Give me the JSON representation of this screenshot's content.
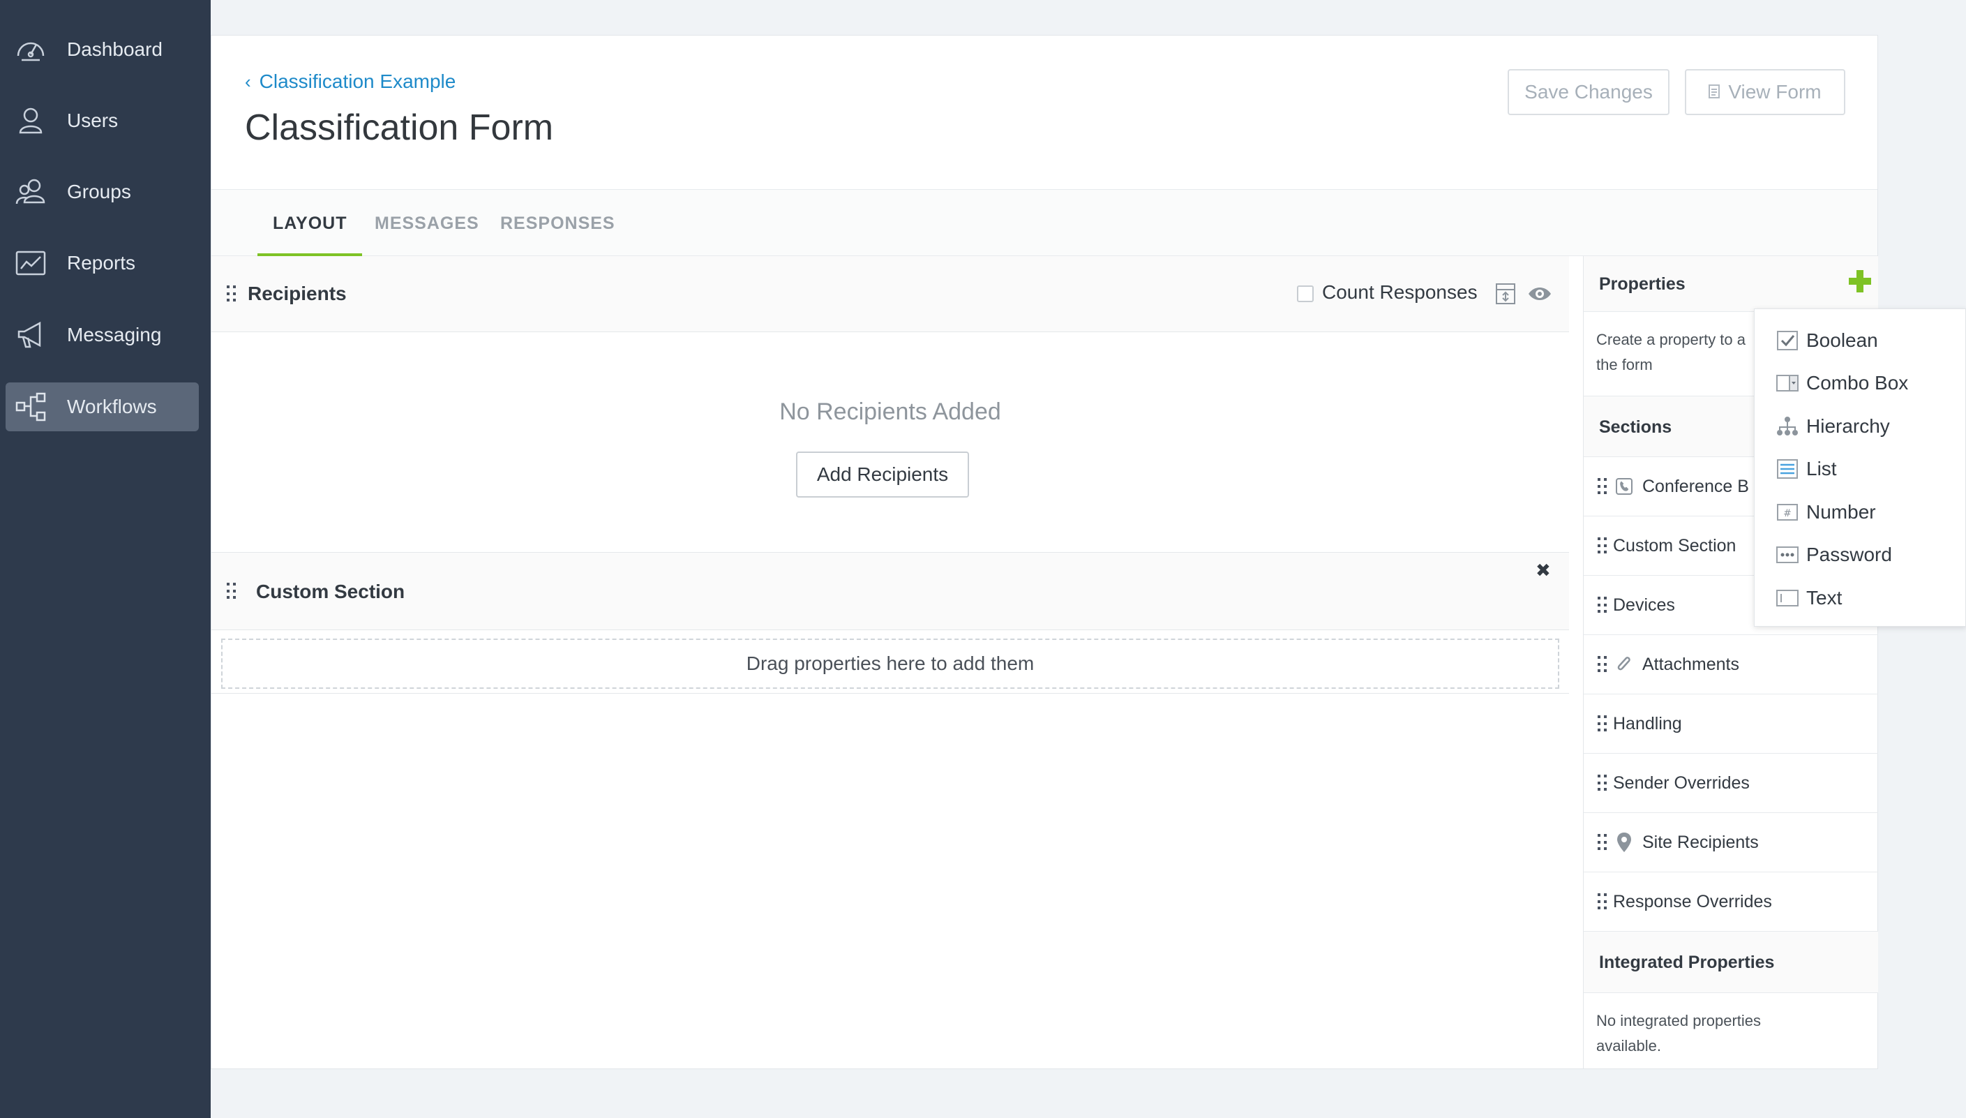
{
  "sidebar": {
    "items": [
      {
        "label": "Dashboard",
        "icon": "dashboard-icon"
      },
      {
        "label": "Users",
        "icon": "user-icon"
      },
      {
        "label": "Groups",
        "icon": "groups-icon"
      },
      {
        "label": "Reports",
        "icon": "reports-icon"
      },
      {
        "label": "Messaging",
        "icon": "megaphone-icon"
      },
      {
        "label": "Workflows",
        "icon": "workflow-icon",
        "active": true
      }
    ]
  },
  "header": {
    "breadcrumb": "Classification Example",
    "title": "Classification Form",
    "save_label": "Save Changes",
    "view_label": "View Form"
  },
  "tabs": [
    {
      "label": "LAYOUT",
      "active": true
    },
    {
      "label": "MESSAGES"
    },
    {
      "label": "RESPONSES"
    }
  ],
  "recipients": {
    "title": "Recipients",
    "count_label": "Count Responses",
    "count_checked": false,
    "empty_text": "No Recipients Added",
    "add_label": "Add Recipients"
  },
  "custom_section": {
    "title": "Custom Section",
    "dropzone_text": "Drag properties here to add them"
  },
  "properties": {
    "title": "Properties",
    "desc_line1": "Create a property to a",
    "desc_line2": "the form",
    "sections_title": "Sections",
    "sections": [
      {
        "label": "Conference B",
        "icon": "phone-icon"
      },
      {
        "label": "Custom Section"
      },
      {
        "label": "Devices"
      },
      {
        "label": "Attachments",
        "icon": "paperclip-icon"
      },
      {
        "label": "Handling"
      },
      {
        "label": "Sender Overrides"
      },
      {
        "label": "Site Recipients",
        "icon": "map-pin-icon"
      },
      {
        "label": "Response Overrides"
      }
    ],
    "integrated_title": "Integrated Properties",
    "integrated_line1": "No integrated properties",
    "integrated_line2": "available."
  },
  "property_types": [
    {
      "label": "Boolean",
      "icon": "checkbox-icon"
    },
    {
      "label": "Combo Box",
      "icon": "combobox-icon"
    },
    {
      "label": "Hierarchy",
      "icon": "hierarchy-icon"
    },
    {
      "label": "List",
      "icon": "list-icon"
    },
    {
      "label": "Number",
      "icon": "number-icon"
    },
    {
      "label": "Password",
      "icon": "password-icon"
    },
    {
      "label": "Text",
      "icon": "text-field-icon"
    }
  ],
  "colors": {
    "sidebar_bg": "#2e3a4c",
    "sidebar_active": "#5b6779",
    "accent_green": "#7ec225",
    "link_blue": "#1e8ac9"
  }
}
